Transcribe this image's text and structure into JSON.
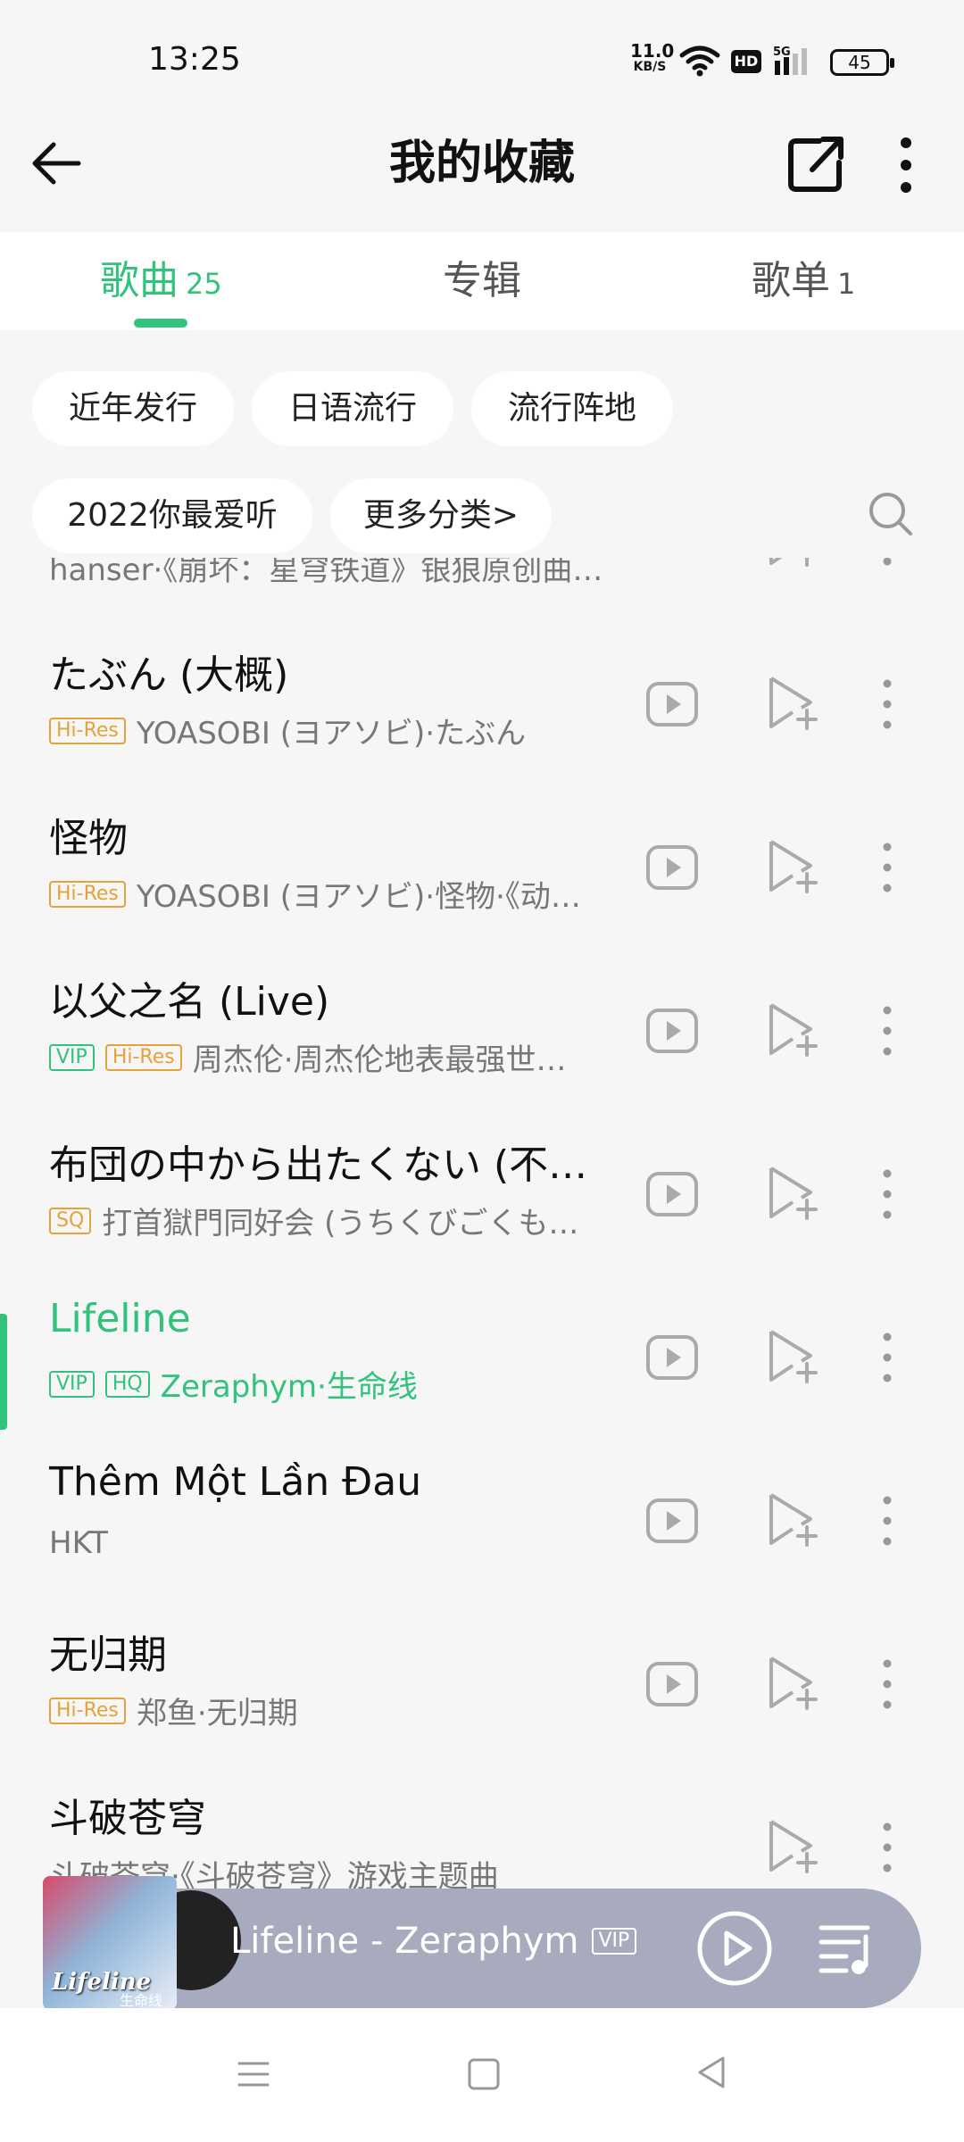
{
  "status_bar": {
    "time": "13:25",
    "net_speed_value": "11.0",
    "net_speed_unit": "KB/S",
    "hd_label": "HD",
    "signal_label": "5G",
    "battery": "45"
  },
  "header": {
    "title": "我的收藏",
    "back_icon": "arrow-left-icon",
    "share_icon": "share-external-icon",
    "more_icon": "more-vertical-icon"
  },
  "tabs": [
    {
      "label": "歌曲",
      "count": "25",
      "active": true
    },
    {
      "label": "专辑",
      "count": "",
      "active": false
    },
    {
      "label": "歌单",
      "count": "1",
      "active": false
    }
  ],
  "chips": [
    "近年发行",
    "日语流行",
    "流行阵地",
    "2022你最爱听",
    "更多分类>"
  ],
  "songs": [
    {
      "title": "",
      "badges": [],
      "subtitle": "hanser·《崩坏：星穹铁道》银狼原创曲手书「…"
    },
    {
      "title": "たぶん (大概)",
      "badges": [
        "Hi-Res"
      ],
      "subtitle": "YOASOBI (ヨアソビ)·たぶん"
    },
    {
      "title": "怪物",
      "badges": [
        "Hi-Res"
      ],
      "subtitle": "YOASOBI (ヨアソビ)·怪物·《动…"
    },
    {
      "title": "以父之名 (Live)",
      "badges": [
        "VIP",
        "Hi-Res"
      ],
      "subtitle": "周杰伦·周杰伦地表最强世…"
    },
    {
      "title": "布団の中から出たくない (不…",
      "badges": [
        "SQ"
      ],
      "subtitle": "打首獄門同好会 (うちくびごくも…"
    },
    {
      "title": "Lifeline",
      "badges": [
        "VIP",
        "HQ"
      ],
      "subtitle": "Zeraphym·生命线",
      "playing": true
    },
    {
      "title": "Thêm Một Lần Đau",
      "badges": [],
      "subtitle": "HKT"
    },
    {
      "title": "无归期",
      "badges": [
        "Hi-Res"
      ],
      "subtitle": "郑鱼·无归期"
    },
    {
      "title": "斗破苍穹",
      "badges": [],
      "subtitle": "斗破苍穹·《斗破苍穹》游戏主题曲"
    }
  ],
  "player": {
    "now_playing": "Lifeline - Zeraphym",
    "badge": "VIP",
    "cover_title": "Lifeline",
    "cover_subtitle": "生命线"
  },
  "colors": {
    "accent": "#31c27c",
    "hires": "#e5a23a",
    "player_bg": "#a7abbd"
  }
}
